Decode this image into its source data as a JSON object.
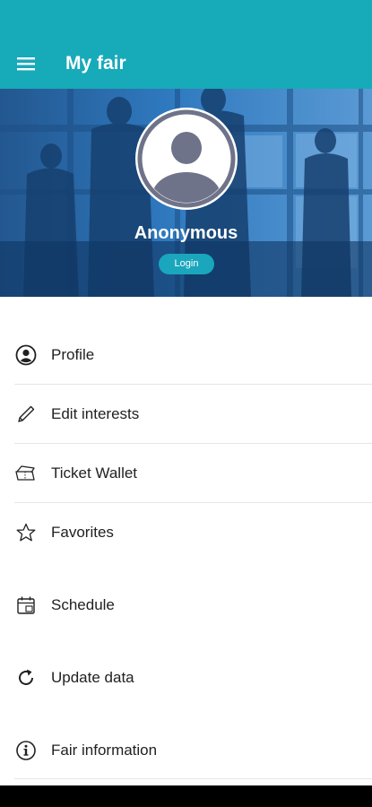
{
  "appbar": {
    "title": "My fair",
    "color": "#17aab9"
  },
  "hero": {
    "user_name": "Anonymous",
    "login_label": "Login"
  },
  "menu": {
    "items": [
      {
        "label": "Profile",
        "icon": "user-circle-icon"
      },
      {
        "label": "Edit interests",
        "icon": "pencil-icon"
      },
      {
        "label": "Ticket Wallet",
        "icon": "ticket-wallet-icon"
      },
      {
        "label": "Favorites",
        "icon": "star-icon"
      },
      {
        "label": "Schedule",
        "icon": "calendar-icon"
      },
      {
        "label": "Update data",
        "icon": "refresh-icon"
      },
      {
        "label": "Fair information",
        "icon": "info-icon"
      }
    ]
  }
}
